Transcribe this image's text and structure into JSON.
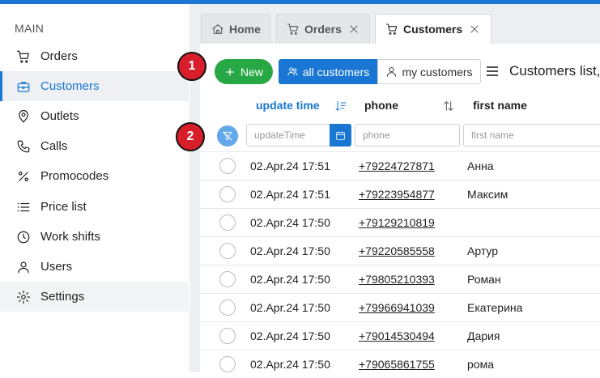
{
  "colors": {
    "accent": "#1976d2",
    "new_button": "#28a745",
    "badge": "#d81e2a"
  },
  "sidebar": {
    "heading": "MAIN",
    "items": [
      {
        "label": "Orders",
        "icon": "cart-icon"
      },
      {
        "label": "Customers",
        "icon": "briefcase-icon",
        "active": true
      },
      {
        "label": "Outlets",
        "icon": "map-pin-icon"
      },
      {
        "label": "Calls",
        "icon": "phone-icon"
      },
      {
        "label": "Promocodes",
        "icon": "percent-icon"
      },
      {
        "label": "Price list",
        "icon": "list-icon"
      },
      {
        "label": "Work shifts",
        "icon": "clock-icon"
      },
      {
        "label": "Users",
        "icon": "user-icon"
      },
      {
        "label": "Settings",
        "icon": "gear-icon"
      }
    ]
  },
  "tabs": [
    {
      "label": "Home",
      "icon": "home-icon",
      "closable": false
    },
    {
      "label": "Orders",
      "icon": "cart-icon",
      "closable": true
    },
    {
      "label": "Customers",
      "icon": "cart-icon",
      "closable": true,
      "active": true
    }
  ],
  "toolbar": {
    "badge": "1",
    "new_label": "New",
    "all_customers_label": "all customers",
    "my_customers_label": "my customers",
    "list_title": "Customers list,"
  },
  "table": {
    "columns": {
      "update_time": "update time",
      "phone": "phone",
      "first_name": "first name"
    },
    "filters": {
      "badge": "2",
      "update_time_placeholder": "updateTime",
      "phone_placeholder": "phone",
      "first_name_placeholder": "first name"
    },
    "rows": [
      {
        "update_time": "02.Apr.24 17:51",
        "phone": "+79224727871",
        "first_name": "Анна"
      },
      {
        "update_time": "02.Apr.24 17:51",
        "phone": "+79223954877",
        "first_name": "Максим"
      },
      {
        "update_time": "02.Apr.24 17:50",
        "phone": "+79129210819",
        "first_name": ""
      },
      {
        "update_time": "02.Apr.24 17:50",
        "phone": "+79220585558",
        "first_name": "Артур"
      },
      {
        "update_time": "02.Apr.24 17:50",
        "phone": "+79805210393",
        "first_name": "Роман"
      },
      {
        "update_time": "02.Apr.24 17:50",
        "phone": "+79966941039",
        "first_name": "Екатерина"
      },
      {
        "update_time": "02.Apr.24 17:50",
        "phone": "+79014530494",
        "first_name": "Дария"
      },
      {
        "update_time": "02.Apr.24 17:50",
        "phone": "+79065861755",
        "first_name": "рома"
      }
    ]
  }
}
